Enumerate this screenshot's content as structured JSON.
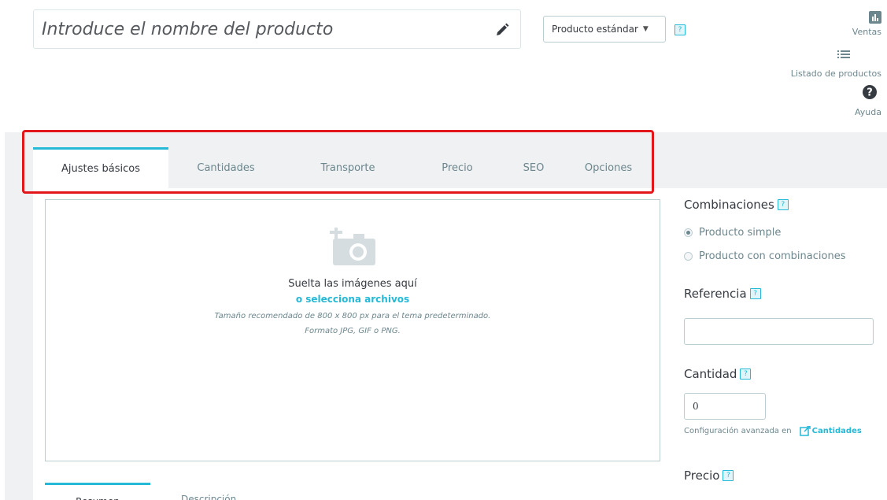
{
  "header": {
    "name_placeholder": "Introduce el nombre del producto",
    "product_type": "Producto estándar",
    "help": "?"
  },
  "right_nav": {
    "ventas": "Ventas",
    "listado": "Listado de productos",
    "ayuda": "Ayuda"
  },
  "tabs": [
    {
      "label": "Ajustes básicos",
      "active": true
    },
    {
      "label": "Cantidades"
    },
    {
      "label": "Transporte"
    },
    {
      "label": "Precio"
    },
    {
      "label": "SEO"
    },
    {
      "label": "Opciones"
    }
  ],
  "dropzone": {
    "drop_text": "Suelta las imágenes aquí",
    "select_text": "o selecciona archivos",
    "size_text": "Tamaño recomendado de 800 x 800 px para el tema predeterminado.",
    "format_text": "Formato JPG, GIF o PNG."
  },
  "sub_tabs": [
    "Resumen",
    "Descripción"
  ],
  "sidebar": {
    "combinations_title": "Combinaciones",
    "radio_simple": "Producto simple",
    "radio_combinations": "Producto con combinaciones",
    "reference_title": "Referencia",
    "reference_value": "",
    "quantity_title": "Cantidad",
    "quantity_value": "0",
    "advanced_text": "Configuración avanzada en",
    "advanced_link": "Cantidades",
    "price_title": "Precio"
  },
  "colors": {
    "accent": "#25b9d7",
    "highlight": "#e3161b",
    "gray_bg": "#eff1f2"
  }
}
